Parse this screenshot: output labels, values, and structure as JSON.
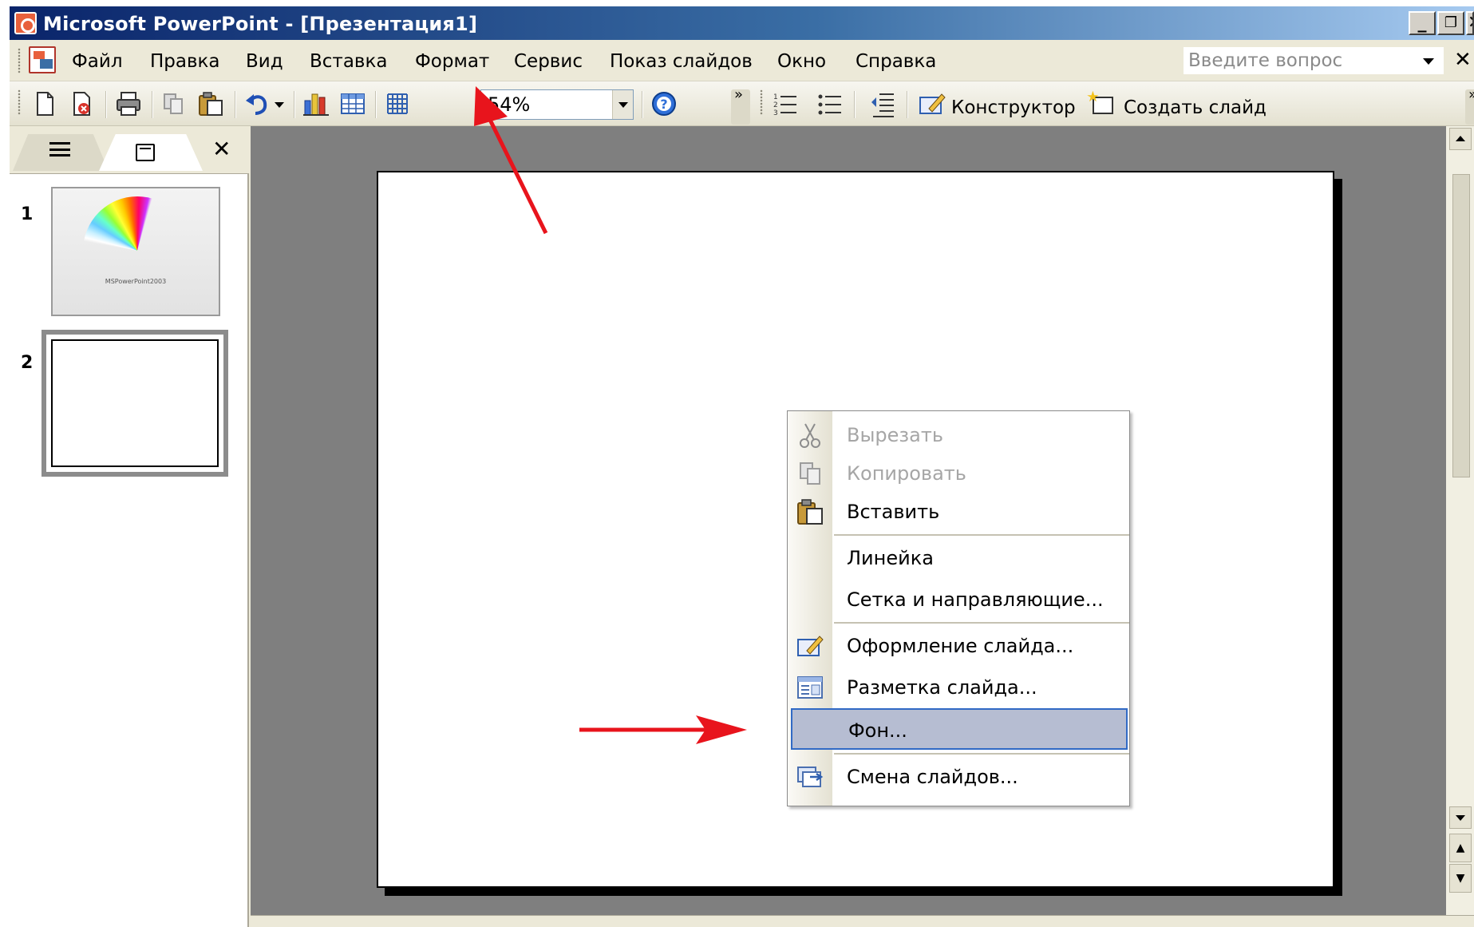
{
  "window": {
    "title": "Microsoft PowerPoint - [Презентация1]",
    "controls": {
      "minimize": "_",
      "restore": "❐",
      "close": "✕"
    }
  },
  "menubar": {
    "items": [
      "Файл",
      "Правка",
      "Вид",
      "Вставка",
      "Формат",
      "Сервис",
      "Показ слайдов",
      "Окно",
      "Справка"
    ],
    "help_placeholder": "Введите вопрос",
    "close_glyph": "✕"
  },
  "toolbar": {
    "zoom": "54%",
    "designer_label": "Конструктор",
    "new_slide_label": "Создать слайд"
  },
  "left_panel": {
    "close_glyph": "✕",
    "slides": [
      {
        "number": "1",
        "title": "MSPowerPoint2003",
        "subtitle": ""
      },
      {
        "number": "2"
      }
    ]
  },
  "context_menu": {
    "items": [
      {
        "label": "Вырезать",
        "icon": "scissors-icon",
        "enabled": false
      },
      {
        "label": "Копировать",
        "icon": "copy-icon",
        "enabled": false
      },
      {
        "label": "Вставить",
        "icon": "paste-icon",
        "enabled": true
      },
      {
        "label": "Линейка",
        "icon": "",
        "enabled": true
      },
      {
        "label": "Сетка и направляющие...",
        "icon": "",
        "enabled": true
      },
      {
        "label": "Оформление слайда...",
        "icon": "slide-design-icon",
        "enabled": true
      },
      {
        "label": "Разметка слайда...",
        "icon": "slide-layout-icon",
        "enabled": true
      },
      {
        "label": "Фон...",
        "icon": "",
        "enabled": true,
        "selected": true
      },
      {
        "label": "Смена слайдов...",
        "icon": "slide-transition-icon",
        "enabled": true
      }
    ]
  },
  "colors": {
    "titlebar_start": "#0a246a",
    "titlebar_end": "#a6caf0",
    "menu_highlight": "#b6bdd2",
    "annotation_arrow": "#e8141c",
    "workspace": "#7f7f7f"
  }
}
